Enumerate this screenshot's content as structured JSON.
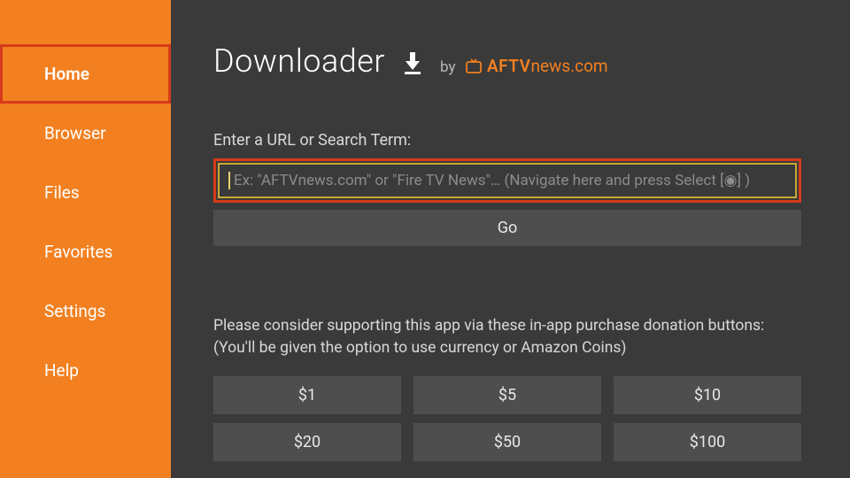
{
  "sidebar": {
    "items": [
      {
        "label": "Home",
        "active": true
      },
      {
        "label": "Browser",
        "active": false
      },
      {
        "label": "Files",
        "active": false
      },
      {
        "label": "Favorites",
        "active": false
      },
      {
        "label": "Settings",
        "active": false
      },
      {
        "label": "Help",
        "active": false
      }
    ]
  },
  "header": {
    "title": "Downloader",
    "by": "by",
    "brand_aftv": "AFTV",
    "brand_news": "news",
    "brand_domain": ".com"
  },
  "main": {
    "url_label": "Enter a URL or Search Term:",
    "url_placeholder": "Ex: \"AFTVnews.com\" or \"Fire TV News\"… (Navigate here and press Select [◉] )",
    "go_label": "Go"
  },
  "donation": {
    "text_line1": "Please consider supporting this app via these in-app purchase donation buttons:",
    "text_line2": "(You'll be given the option to use currency or Amazon Coins)",
    "amounts": [
      "$1",
      "$5",
      "$10",
      "$20",
      "$50",
      "$100"
    ]
  },
  "colors": {
    "accent": "#f28020",
    "highlight": "#d63b1a",
    "focus_border": "#c9a838",
    "bg": "#3a3a3a",
    "button_bg": "#4e4e4e"
  }
}
